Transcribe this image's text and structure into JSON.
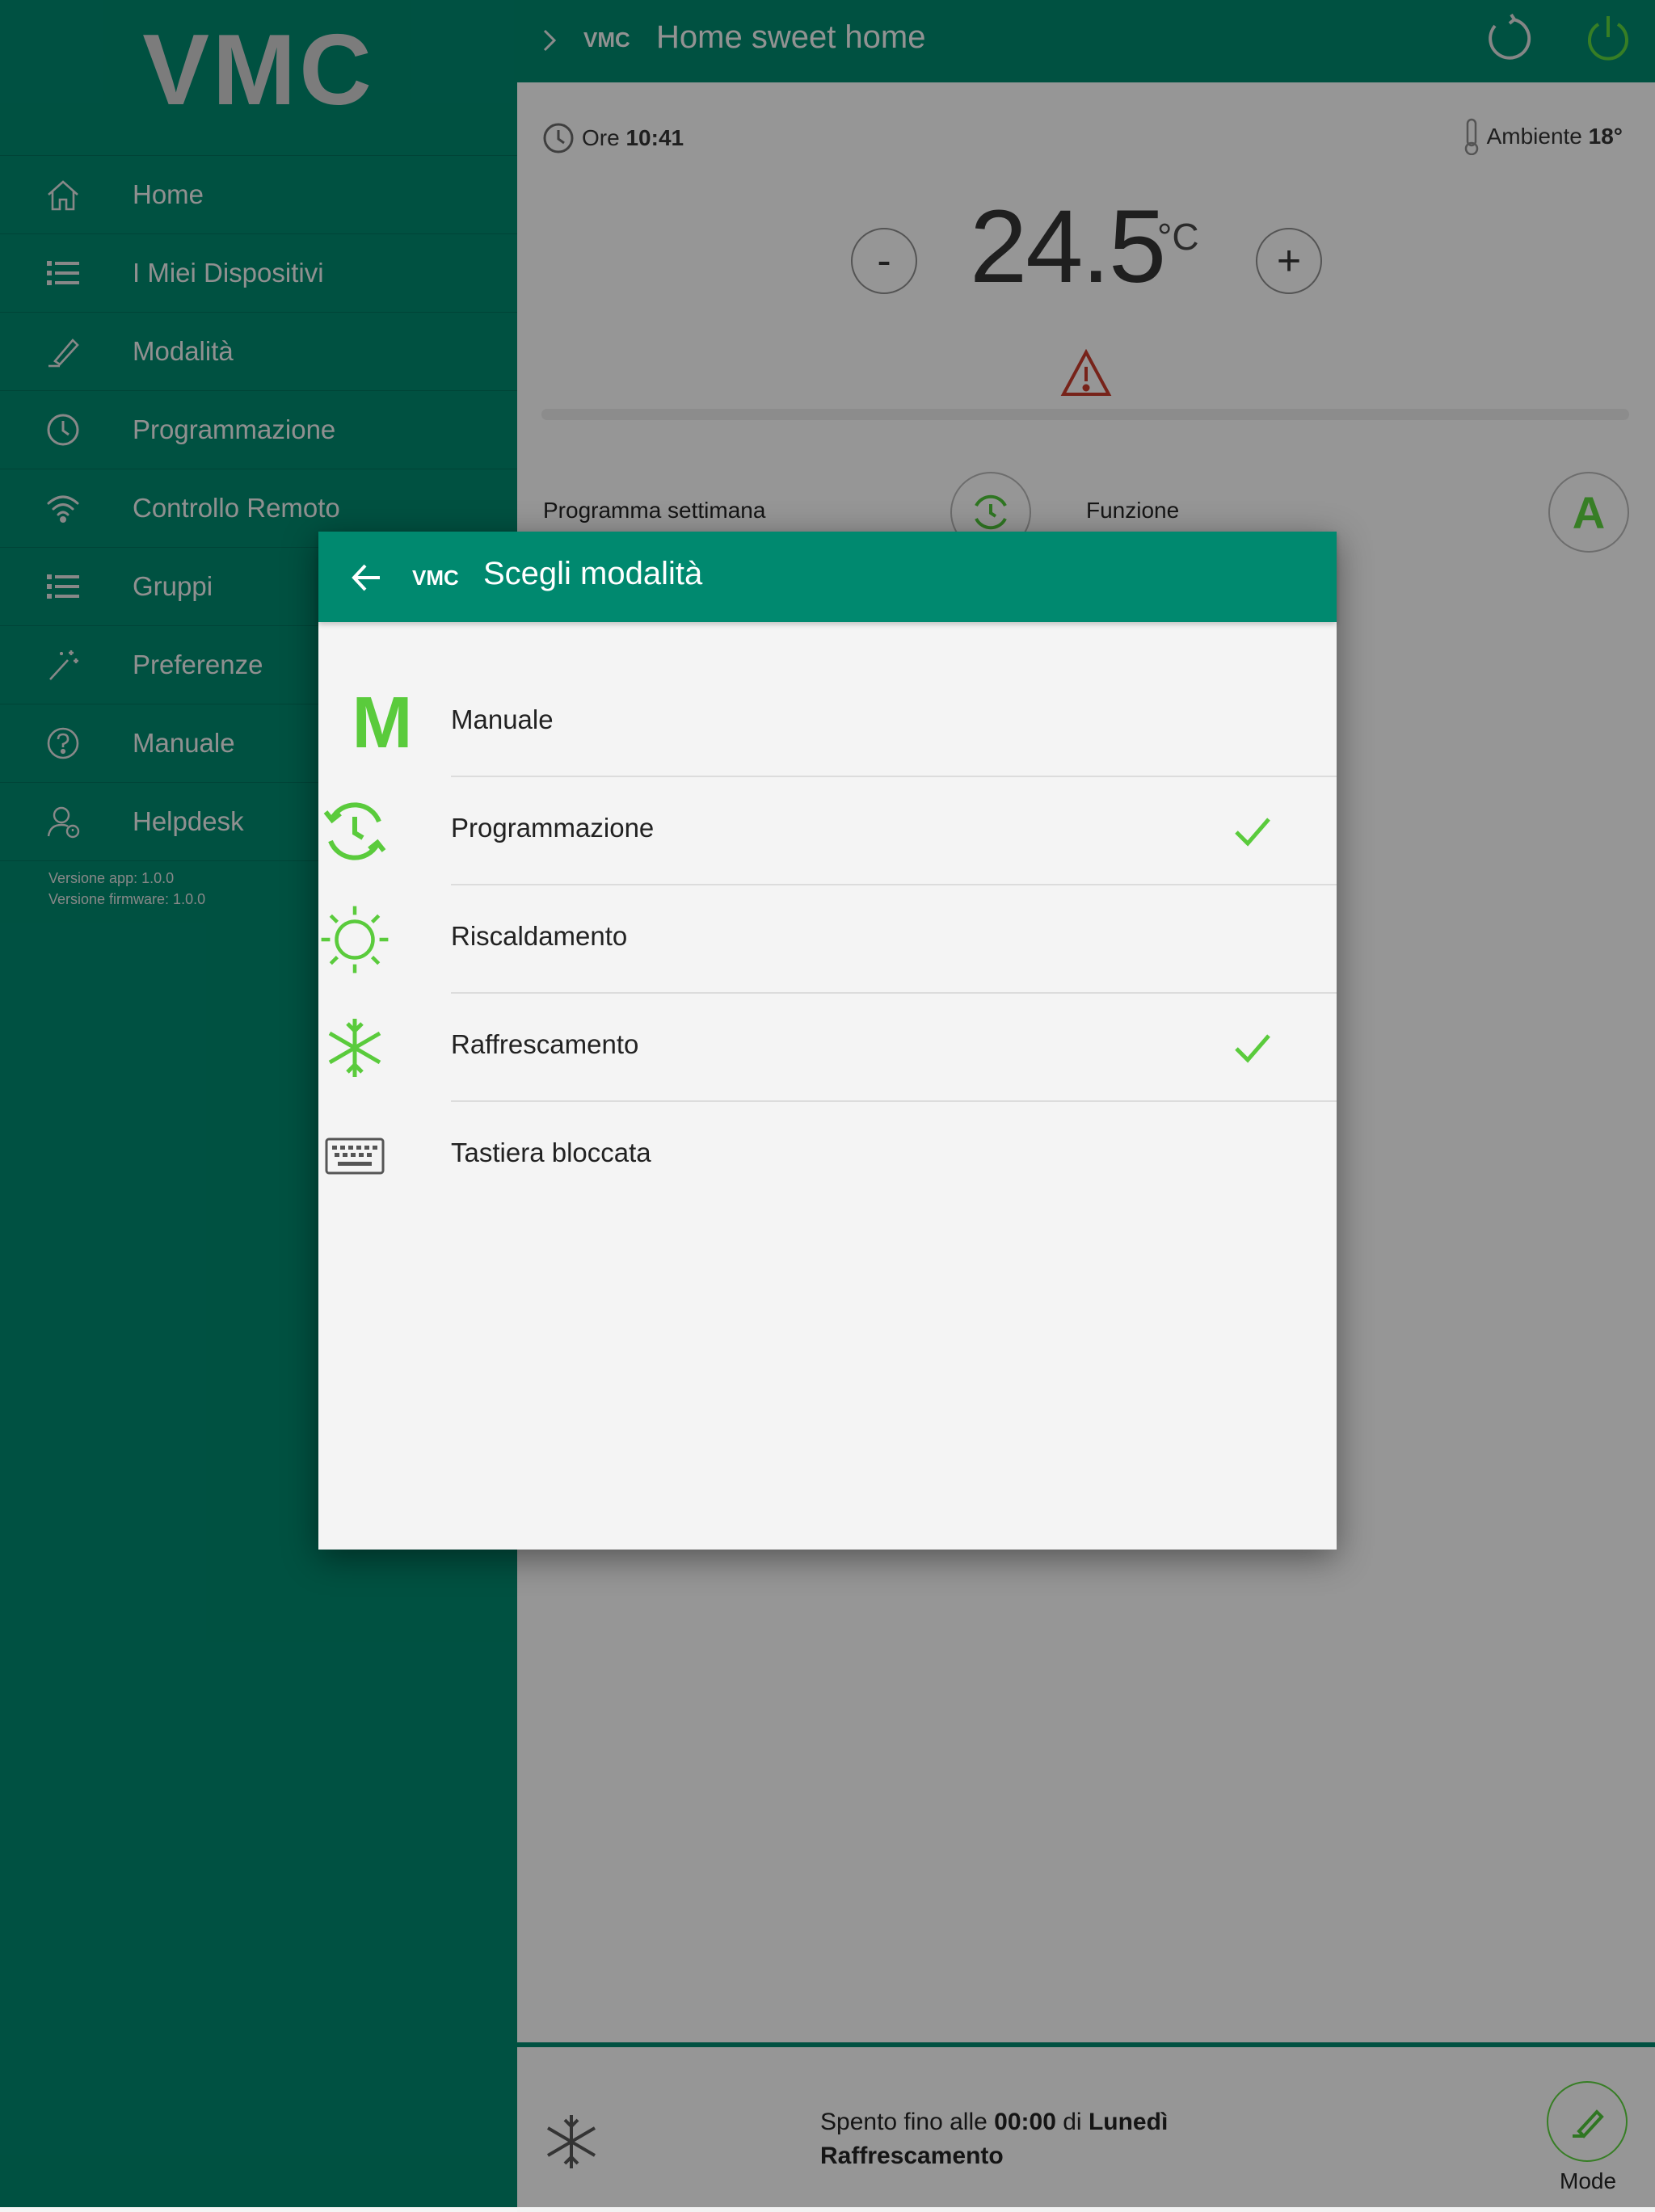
{
  "colors": {
    "brand_green": "#00836a",
    "accent_green": "#5acb3c",
    "warning": "#c0392b"
  },
  "sidebar": {
    "logo": "VMC",
    "items": [
      {
        "label": "Home",
        "icon": "home-icon"
      },
      {
        "label": "I Miei Dispositivi",
        "icon": "list-icon"
      },
      {
        "label": "Modalità",
        "icon": "pencil-icon"
      },
      {
        "label": "Programmazione",
        "icon": "clock-icon"
      },
      {
        "label": "Controllo Remoto",
        "icon": "wifi-icon"
      },
      {
        "label": "Gruppi",
        "icon": "list-icon"
      },
      {
        "label": "Preferenze",
        "icon": "magic-wand-icon"
      },
      {
        "label": "Manuale",
        "icon": "help-icon"
      },
      {
        "label": "Helpdesk",
        "icon": "support-agent-icon"
      }
    ],
    "version_app": "Versione app: 1.0.0",
    "version_firmware": "Versione firmware: 1.0.0"
  },
  "header": {
    "device_badge": "VMC",
    "title": "Home sweet home"
  },
  "main": {
    "time_label": "Ore",
    "time_value": "10:41",
    "ambient_label": "Ambiente",
    "ambient_value": "18°",
    "setpoint": "24.5",
    "unit": "°C",
    "minus": "-",
    "plus": "+",
    "progress_fraction": 0,
    "program_label": "Programma settimana",
    "function_label": "Funzione",
    "function_letter": "A"
  },
  "footer": {
    "status_prefix": "Spento fino alle",
    "status_time": "00:00",
    "status_mid": "di",
    "status_day": "Lunedì",
    "status_mode": "Raffrescamento",
    "mode_label": "Mode"
  },
  "dialog": {
    "device_badge": "VMC",
    "title": "Scegli modalità",
    "options": [
      {
        "label": "Manuale",
        "icon": "m-letter-icon",
        "checked": false
      },
      {
        "label": "Programmazione",
        "icon": "schedule-clock-icon",
        "checked": true
      },
      {
        "label": "Riscaldamento",
        "icon": "sun-icon",
        "checked": false
      },
      {
        "label": "Raffrescamento",
        "icon": "snowflake-icon",
        "checked": true
      },
      {
        "label": "Tastiera bloccata",
        "icon": "keyboard-icon",
        "checked": false
      }
    ]
  }
}
